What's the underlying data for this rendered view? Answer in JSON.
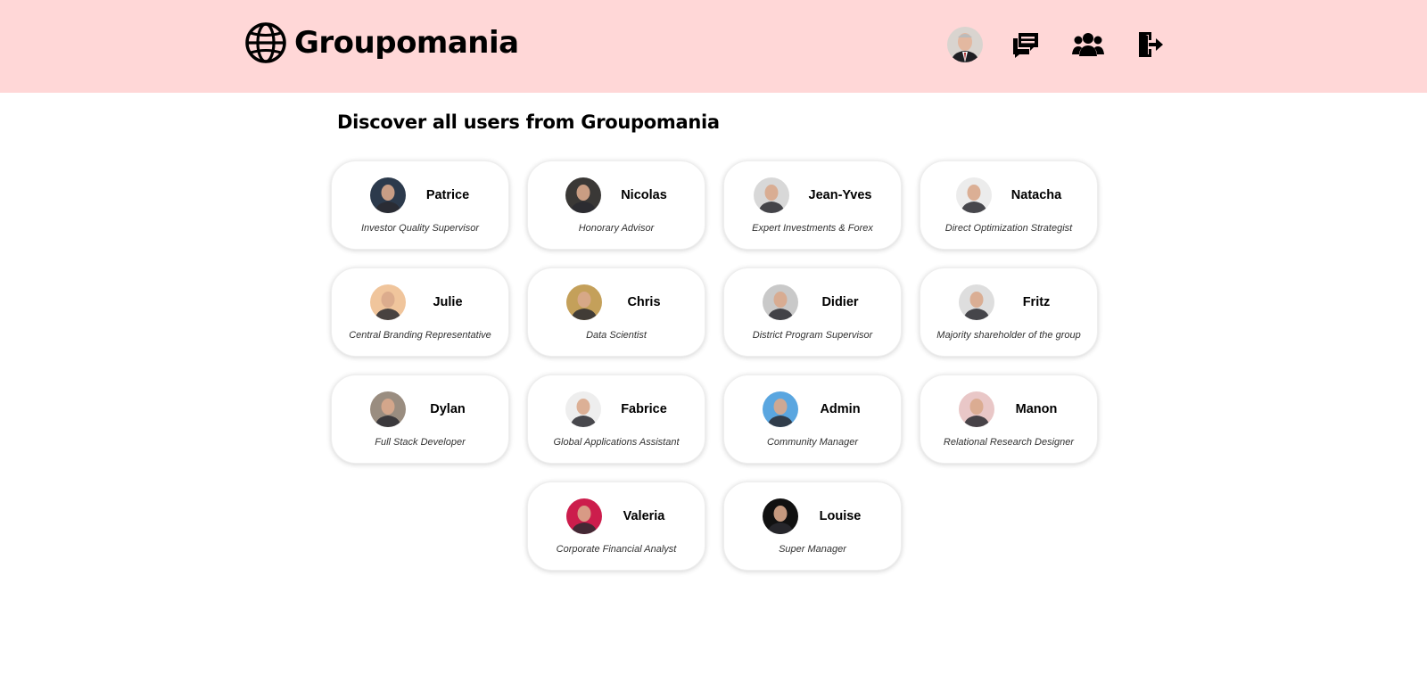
{
  "header": {
    "brand": "Groupomania",
    "nav": [
      {
        "name": "profile-avatar",
        "icon": "user-avatar"
      },
      {
        "name": "posts",
        "icon": "messages-icon"
      },
      {
        "name": "users",
        "icon": "users-icon"
      },
      {
        "name": "logout",
        "icon": "logout-icon"
      }
    ]
  },
  "main": {
    "title": "Discover all users from Groupomania",
    "users": [
      {
        "name": "Patrice",
        "role": "Investor Quality Supervisor",
        "avatar_color": "#2c3a4c"
      },
      {
        "name": "Nicolas",
        "role": "Honorary Advisor",
        "avatar_color": "#3a3836"
      },
      {
        "name": "Jean-Yves",
        "role": "Expert Investments & Forex",
        "avatar_color": "#d8d8d8"
      },
      {
        "name": "Natacha",
        "role": "Direct Optimization Strategist",
        "avatar_color": "#ececec"
      },
      {
        "name": "Julie",
        "role": "Central Branding Representative",
        "avatar_color": "#f0c59c"
      },
      {
        "name": "Chris",
        "role": "Data Scientist",
        "avatar_color": "#c4a05a"
      },
      {
        "name": "Didier",
        "role": "District Program Supervisor",
        "avatar_color": "#c9c9c9"
      },
      {
        "name": "Fritz",
        "role": "Majority shareholder of the group",
        "avatar_color": "#dedede"
      },
      {
        "name": "Dylan",
        "role": "Full Stack Developer",
        "avatar_color": "#9a8d80"
      },
      {
        "name": "Fabrice",
        "role": "Global Applications Assistant",
        "avatar_color": "#eeeeee"
      },
      {
        "name": "Admin",
        "role": "Community Manager",
        "avatar_color": "#5aa6e0"
      },
      {
        "name": "Manon",
        "role": "Relational Research Designer",
        "avatar_color": "#e9c7c7"
      },
      {
        "name": "Valeria",
        "role": "Corporate Financial Analyst",
        "avatar_color": "#cc1d4c"
      },
      {
        "name": "Louise",
        "role": "Super Manager",
        "avatar_color": "#111111"
      }
    ]
  },
  "colors": {
    "header_bg": "#ffd7d7",
    "card_bg": "#ffffff",
    "role_text": "#333333"
  }
}
